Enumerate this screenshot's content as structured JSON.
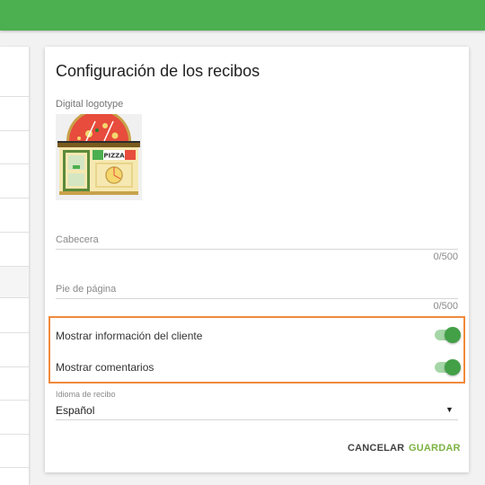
{
  "colors": {
    "appbar": "#4caf50",
    "accent": "#7cb342",
    "toggle_on": "#43a047",
    "highlight": "#f08a3c"
  },
  "card": {
    "title": "Configuración de los recibos",
    "logo_label": "Digital logotype",
    "logo_sign": "PIZZA",
    "header_field": {
      "label": "Cabecera",
      "counter": "0/500"
    },
    "footer_field": {
      "label": "Pie de página",
      "counter": "0/500"
    },
    "toggles": [
      {
        "label": "Mostrar información del cliente",
        "on": true
      },
      {
        "label": "Mostrar comentarios",
        "on": true
      }
    ],
    "language": {
      "label": "Idioma de recibo",
      "value": "Español",
      "arrow_icon": "dropdown-arrow-icon"
    },
    "buttons": {
      "cancel": "CANCELAR",
      "save": "GUARDAR"
    }
  }
}
